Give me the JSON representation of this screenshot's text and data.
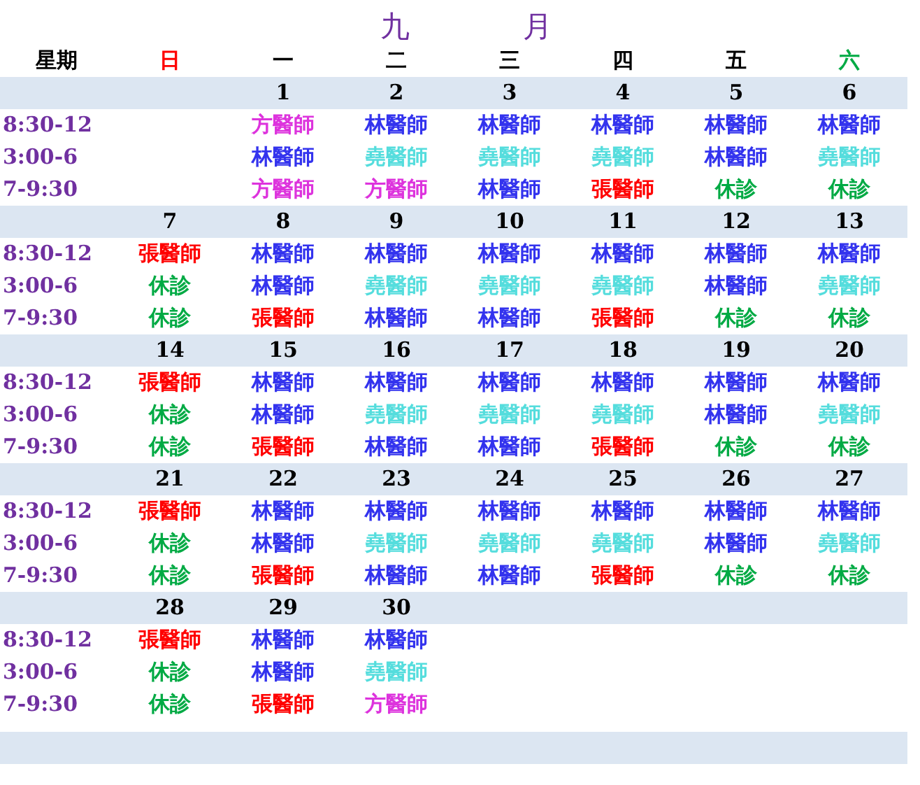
{
  "title": "九　月",
  "weekdays": [
    {
      "label": "星期",
      "color": "#000000"
    },
    {
      "label": "日",
      "color": "#ff0000"
    },
    {
      "label": "一",
      "color": "#000000"
    },
    {
      "label": "二",
      "color": "#000000"
    },
    {
      "label": "三",
      "color": "#000000"
    },
    {
      "label": "四",
      "color": "#000000"
    },
    {
      "label": "五",
      "color": "#000000"
    },
    {
      "label": "六",
      "color": "#00aa44"
    }
  ],
  "weeks": [
    {
      "times": [
        "8:30-12",
        "3:00-6",
        "7-9:30"
      ],
      "days": [
        {
          "date": "1",
          "slots": [
            {
              "text": "方醫師",
              "color": "#dd33dd"
            },
            {
              "text": "林醫師",
              "color": "#3333ee"
            },
            {
              "text": "方醫師",
              "color": "#dd33dd"
            }
          ]
        },
        {
          "date": "2",
          "slots": [
            {
              "text": "林醫師",
              "color": "#3333ee"
            },
            {
              "text": "堯醫師",
              "color": "#55dddd"
            },
            {
              "text": "方醫師",
              "color": "#dd33dd"
            }
          ]
        },
        {
          "date": "3",
          "slots": [
            {
              "text": "林醫師",
              "color": "#3333ee"
            },
            {
              "text": "堯醫師",
              "color": "#55dddd"
            },
            {
              "text": "林醫師",
              "color": "#3333ee"
            }
          ]
        },
        {
          "date": "4",
          "slots": [
            {
              "text": "林醫師",
              "color": "#3333ee"
            },
            {
              "text": "堯醫師",
              "color": "#55dddd"
            },
            {
              "text": "張醫師",
              "color": "#ff0000"
            }
          ]
        },
        {
          "date": "5",
          "slots": [
            {
              "text": "林醫師",
              "color": "#3333ee"
            },
            {
              "text": "林醫師",
              "color": "#3333ee"
            },
            {
              "text": "休診",
              "color": "#00aa44"
            }
          ]
        },
        {
          "date": "6",
          "slots": [
            {
              "text": "林醫師",
              "color": "#3333ee"
            },
            {
              "text": "堯醫師",
              "color": "#55dddd"
            },
            {
              "text": "休診",
              "color": "#00aa44"
            }
          ]
        }
      ]
    },
    {
      "times": [
        "8:30-12",
        "3:00-6",
        "7-9:30"
      ],
      "days": [
        {
          "date": "7",
          "slots": [
            {
              "text": "張醫師",
              "color": "#ff0000"
            },
            {
              "text": "休診",
              "color": "#00aa44"
            },
            {
              "text": "休診",
              "color": "#00aa44"
            }
          ]
        },
        {
          "date": "8",
          "slots": [
            {
              "text": "林醫師",
              "color": "#3333ee"
            },
            {
              "text": "林醫師",
              "color": "#3333ee"
            },
            {
              "text": "張醫師",
              "color": "#ff0000"
            }
          ]
        },
        {
          "date": "9",
          "slots": [
            {
              "text": "林醫師",
              "color": "#3333ee"
            },
            {
              "text": "堯醫師",
              "color": "#55dddd"
            },
            {
              "text": "林醫師",
              "color": "#3333ee"
            }
          ]
        },
        {
          "date": "10",
          "slots": [
            {
              "text": "林醫師",
              "color": "#3333ee"
            },
            {
              "text": "堯醫師",
              "color": "#55dddd"
            },
            {
              "text": "林醫師",
              "color": "#3333ee"
            }
          ]
        },
        {
          "date": "11",
          "slots": [
            {
              "text": "林醫師",
              "color": "#3333ee"
            },
            {
              "text": "堯醫師",
              "color": "#55dddd"
            },
            {
              "text": "張醫師",
              "color": "#ff0000"
            }
          ]
        },
        {
          "date": "12",
          "slots": [
            {
              "text": "林醫師",
              "color": "#3333ee"
            },
            {
              "text": "林醫師",
              "color": "#3333ee"
            },
            {
              "text": "休診",
              "color": "#00aa44"
            }
          ]
        },
        {
          "date": "13",
          "slots": [
            {
              "text": "林醫師",
              "color": "#3333ee"
            },
            {
              "text": "堯醫師",
              "color": "#55dddd"
            },
            {
              "text": "休診",
              "color": "#00aa44"
            }
          ]
        }
      ]
    },
    {
      "times": [
        "8:30-12",
        "3:00-6",
        "7-9:30"
      ],
      "days": [
        {
          "date": "14",
          "slots": [
            {
              "text": "張醫師",
              "color": "#ff0000"
            },
            {
              "text": "休診",
              "color": "#00aa44"
            },
            {
              "text": "休診",
              "color": "#00aa44"
            }
          ]
        },
        {
          "date": "15",
          "slots": [
            {
              "text": "林醫師",
              "color": "#3333ee"
            },
            {
              "text": "林醫師",
              "color": "#3333ee"
            },
            {
              "text": "張醫師",
              "color": "#ff0000"
            }
          ]
        },
        {
          "date": "16",
          "slots": [
            {
              "text": "林醫師",
              "color": "#3333ee"
            },
            {
              "text": "堯醫師",
              "color": "#55dddd"
            },
            {
              "text": "林醫師",
              "color": "#3333ee"
            }
          ]
        },
        {
          "date": "17",
          "slots": [
            {
              "text": "林醫師",
              "color": "#3333ee"
            },
            {
              "text": "堯醫師",
              "color": "#55dddd"
            },
            {
              "text": "林醫師",
              "color": "#3333ee"
            }
          ]
        },
        {
          "date": "18",
          "slots": [
            {
              "text": "林醫師",
              "color": "#3333ee"
            },
            {
              "text": "堯醫師",
              "color": "#55dddd"
            },
            {
              "text": "張醫師",
              "color": "#ff0000"
            }
          ]
        },
        {
          "date": "19",
          "slots": [
            {
              "text": "林醫師",
              "color": "#3333ee"
            },
            {
              "text": "林醫師",
              "color": "#3333ee"
            },
            {
              "text": "休診",
              "color": "#00aa44"
            }
          ]
        },
        {
          "date": "20",
          "slots": [
            {
              "text": "林醫師",
              "color": "#3333ee"
            },
            {
              "text": "堯醫師",
              "color": "#55dddd"
            },
            {
              "text": "休診",
              "color": "#00aa44"
            }
          ]
        }
      ]
    },
    {
      "times": [
        "8:30-12",
        "3:00-6",
        "7-9:30"
      ],
      "days": [
        {
          "date": "21",
          "slots": [
            {
              "text": "張醫師",
              "color": "#ff0000"
            },
            {
              "text": "休診",
              "color": "#00aa44"
            },
            {
              "text": "休診",
              "color": "#00aa44"
            }
          ]
        },
        {
          "date": "22",
          "slots": [
            {
              "text": "林醫師",
              "color": "#3333ee"
            },
            {
              "text": "林醫師",
              "color": "#3333ee"
            },
            {
              "text": "張醫師",
              "color": "#ff0000"
            }
          ]
        },
        {
          "date": "23",
          "slots": [
            {
              "text": "林醫師",
              "color": "#3333ee"
            },
            {
              "text": "堯醫師",
              "color": "#55dddd"
            },
            {
              "text": "林醫師",
              "color": "#3333ee"
            }
          ]
        },
        {
          "date": "24",
          "slots": [
            {
              "text": "林醫師",
              "color": "#3333ee"
            },
            {
              "text": "堯醫師",
              "color": "#55dddd"
            },
            {
              "text": "林醫師",
              "color": "#3333ee"
            }
          ]
        },
        {
          "date": "25",
          "slots": [
            {
              "text": "林醫師",
              "color": "#3333ee"
            },
            {
              "text": "堯醫師",
              "color": "#55dddd"
            },
            {
              "text": "張醫師",
              "color": "#ff0000"
            }
          ]
        },
        {
          "date": "26",
          "slots": [
            {
              "text": "林醫師",
              "color": "#3333ee"
            },
            {
              "text": "林醫師",
              "color": "#3333ee"
            },
            {
              "text": "休診",
              "color": "#00aa44"
            }
          ]
        },
        {
          "date": "27",
          "slots": [
            {
              "text": "林醫師",
              "color": "#3333ee"
            },
            {
              "text": "堯醫師",
              "color": "#55dddd"
            },
            {
              "text": "休診",
              "color": "#00aa44"
            }
          ]
        }
      ]
    },
    {
      "times": [
        "8:30-12",
        "3:00-6",
        "7-9:30"
      ],
      "days": [
        {
          "date": "28",
          "slots": [
            {
              "text": "張醫師",
              "color": "#ff0000"
            },
            {
              "text": "休診",
              "color": "#00aa44"
            },
            {
              "text": "休診",
              "color": "#00aa44"
            }
          ]
        },
        {
          "date": "29",
          "slots": [
            {
              "text": "林醫師",
              "color": "#3333ee"
            },
            {
              "text": "林醫師",
              "color": "#3333ee"
            },
            {
              "text": "張醫師",
              "color": "#ff0000"
            }
          ]
        },
        {
          "date": "30",
          "slots": [
            {
              "text": "林醫師",
              "color": "#3333ee"
            },
            {
              "text": "堯醫師",
              "color": "#55dddd"
            },
            {
              "text": "方醫師",
              "color": "#dd33dd"
            }
          ]
        }
      ]
    }
  ]
}
